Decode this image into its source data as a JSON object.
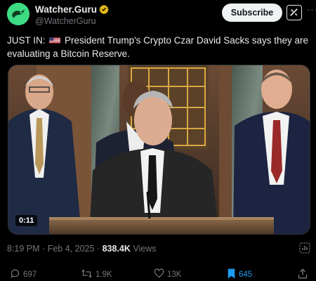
{
  "account": {
    "name": "Watcher.Guru",
    "handle": "@WatcherGuru"
  },
  "header": {
    "subscribe_label": "Subscribe",
    "grok_icon": "grok-icon",
    "more_icon": "more-dots-icon"
  },
  "tweet": {
    "prefix": "JUST IN:",
    "flag_icon": "us-flag-icon",
    "body": "President Trump's Crypto Czar David Sacks says they are evaluating a Bitcoin Reserve."
  },
  "media": {
    "duration": "0:11"
  },
  "meta": {
    "time": "8:19 PM",
    "separator": "·",
    "date": "Feb 4, 2025",
    "views_count": "838.4K",
    "views_label": "Views"
  },
  "actions": {
    "replies": "697",
    "reposts": "1.9K",
    "likes": "13K",
    "bookmarks": "645"
  },
  "colors": {
    "background": "#000000",
    "text": "#e7e9ea",
    "muted": "#71767b",
    "accent": "#1d9bf0",
    "avatar": "#3ddc84"
  }
}
